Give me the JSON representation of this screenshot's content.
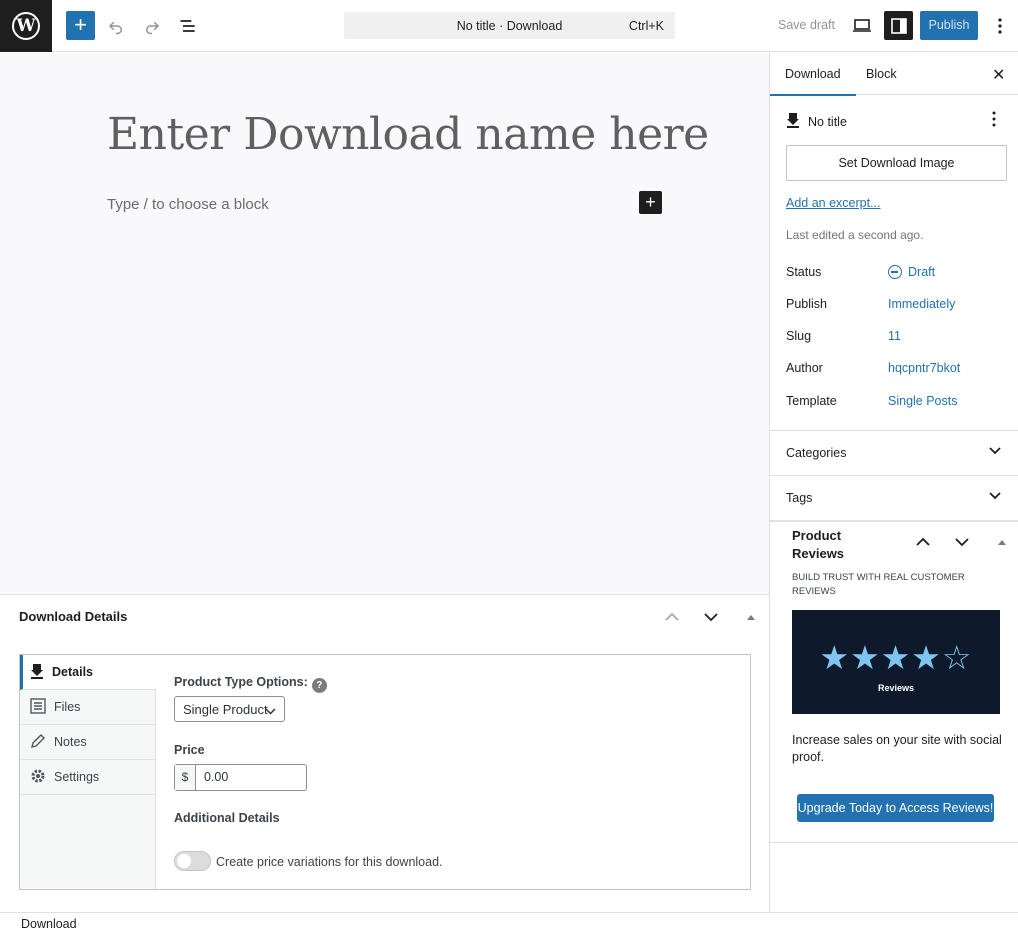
{
  "topbar": {
    "logo_letter": "W",
    "add_glyph": "+",
    "document_title": "No title · Download",
    "shortcut": "Ctrl+K",
    "save_draft": "Save draft",
    "publish": "Publish",
    "icons": [
      "wordpress-logo-icon",
      "plus-icon",
      "undo-icon",
      "redo-icon",
      "list-view-icon",
      "desktop-view-icon",
      "sidebar-toggle-icon",
      "more-options-icon"
    ]
  },
  "editor": {
    "title_placeholder": "Enter Download name here",
    "block_hint": "Type / to choose a block",
    "add_block_glyph": "+"
  },
  "metabox": {
    "title": "Download Details",
    "tabs": [
      {
        "label": "Details",
        "icon": "download-icon",
        "active": true
      },
      {
        "label": "Files",
        "icon": "list-icon",
        "active": false
      },
      {
        "label": "Notes",
        "icon": "pencil-icon",
        "active": false
      },
      {
        "label": "Settings",
        "icon": "gear-icon",
        "active": false
      }
    ],
    "product_type_label": "Product Type Options:",
    "help_glyph": "?",
    "product_type_value": "Single Product",
    "price_label": "Price",
    "currency": "$",
    "price_value": "0.00",
    "additional_label": "Additional Details",
    "variations_toggle_on": false,
    "variations_label": "Create price variations for this download."
  },
  "sidebar": {
    "tabs": [
      "Download",
      "Block"
    ],
    "active_tab": "Download",
    "close_glyph": "✕",
    "post_title": "No title",
    "set_image": "Set Download Image",
    "add_excerpt": "Add an excerpt...",
    "last_edited": "Last edited a second ago.",
    "meta": [
      {
        "key": "Status",
        "value": "Draft"
      },
      {
        "key": "Publish",
        "value": "Immediately"
      },
      {
        "key": "Slug",
        "value": "11"
      },
      {
        "key": "Author",
        "value": "hqcpntr7bkot"
      },
      {
        "key": "Template",
        "value": "Single Posts"
      }
    ],
    "panels": [
      "Categories",
      "Tags"
    ],
    "promo": {
      "title": "Product Reviews",
      "tagline": "BUILD TRUST WITH REAL CUSTOMER REVIEWS",
      "stars": "★★★★☆",
      "rating": 4.5,
      "image_label": "Reviews",
      "description": "Increase sales on your site with social proof.",
      "button": "Upgrade Today to Access Reviews!"
    }
  },
  "footer": {
    "breadcrumb": "Download"
  },
  "colors": {
    "accent": "#2271b1",
    "dark": "#1e1e1e",
    "canvas": "#f9f8fa"
  }
}
